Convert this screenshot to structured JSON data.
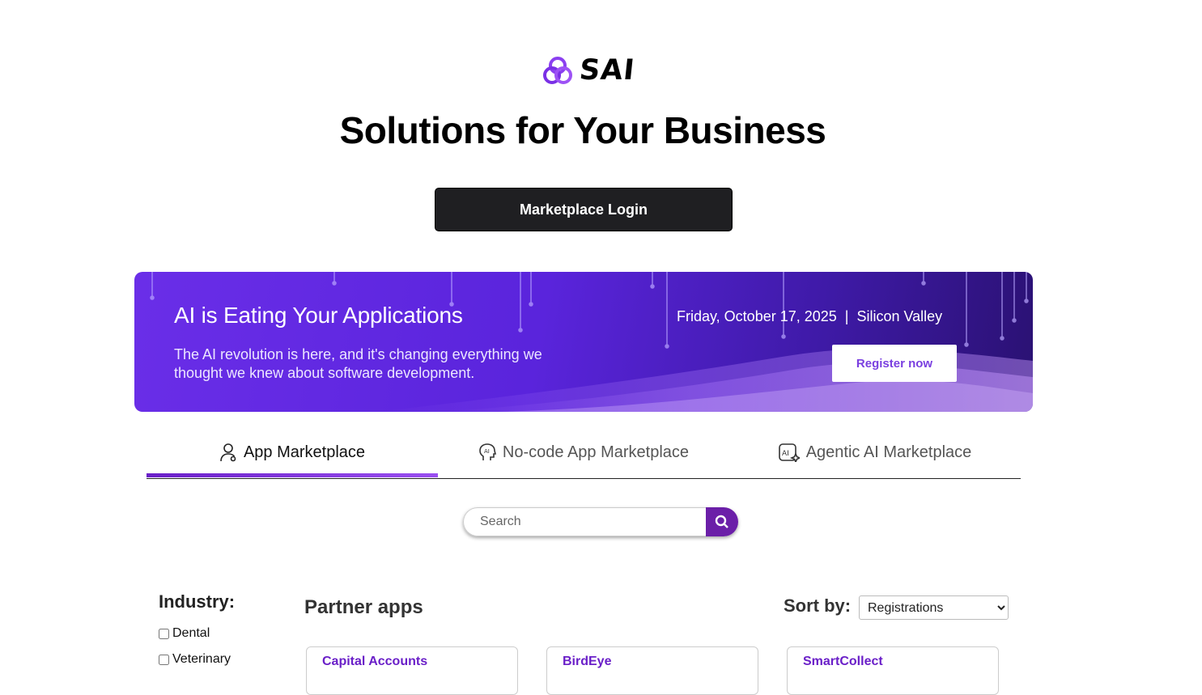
{
  "brand": {
    "name": "SAI",
    "accent": "#8b3ff0"
  },
  "hero": {
    "title": "Solutions for Your Business"
  },
  "login_button": {
    "label": "Marketplace Login"
  },
  "banner": {
    "title": "AI is Eating Your Applications",
    "description": "The AI revolution is here, and it's changing everything we thought we knew about software development.",
    "date": "Friday, October 17, 2025",
    "separator": "|",
    "location": "Silicon Valley",
    "register_label": "Register now"
  },
  "tabs": [
    {
      "label": "App Marketplace",
      "icon": "user-icon",
      "active": true
    },
    {
      "label": "No-code App Marketplace",
      "icon": "ai-head-icon",
      "active": false
    },
    {
      "label": "Agentic AI Marketplace",
      "icon": "ai-sparkle-icon",
      "active": false
    }
  ],
  "search": {
    "placeholder": "Search",
    "icon": "search-icon"
  },
  "filters": {
    "industry_title": "Industry:",
    "options": [
      {
        "label": "Dental",
        "checked": false
      },
      {
        "label": "Veterinary",
        "checked": false
      }
    ]
  },
  "apps": {
    "title": "Partner apps",
    "sort_label": "Sort by:",
    "sort_selected": "Registrations",
    "cards": [
      {
        "name": "Capital Accounts"
      },
      {
        "name": "BirdEye"
      },
      {
        "name": "SmartCollect"
      }
    ]
  }
}
